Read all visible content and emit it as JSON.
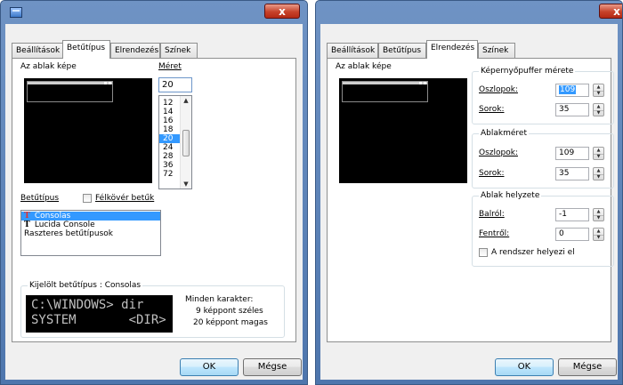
{
  "left_window": {
    "title": "",
    "close_label": "x",
    "tabs": [
      {
        "label": "Beállítások",
        "active": false
      },
      {
        "label": "Betűtípus",
        "active": true
      },
      {
        "label": "Elrendezés",
        "active": false
      },
      {
        "label": "Színek",
        "active": false
      }
    ],
    "preview_label": "Az ablak képe",
    "size_label": "Méret",
    "size_value": "20",
    "size_options": [
      "12",
      "14",
      "16",
      "18",
      "20",
      "24",
      "28",
      "36",
      "72"
    ],
    "selected_size": "20",
    "font_label": "Betűtípus",
    "bold_label": "Félkövér betűk",
    "bold_checked": false,
    "fonts": [
      {
        "icon": "T",
        "name": "Consolas",
        "selected": true
      },
      {
        "icon": "T",
        "name": "Lucida Console",
        "selected": false
      },
      {
        "icon": "",
        "name": "Raszteres betűtípusok",
        "selected": false
      }
    ],
    "selected_font_group_title": "Kijelölt betűtípus : Consolas",
    "sample_line1": "C:\\WINDOWS> dir",
    "sample_line2": "SYSTEM       <DIR>",
    "info_title": "Minden karakter:",
    "info_width": "9 képpont széles",
    "info_height": "20 képpont magas",
    "ok_label": "OK",
    "cancel_label": "Mégse"
  },
  "right_window": {
    "title": "",
    "close_label": "x",
    "tabs": [
      {
        "label": "Beállítások",
        "active": false
      },
      {
        "label": "Betűtípus",
        "active": false
      },
      {
        "label": "Elrendezés",
        "active": true
      },
      {
        "label": "Színek",
        "active": false
      }
    ],
    "preview_label": "Az ablak képe",
    "buffer_group_title": "Képernyőpuffer mérete",
    "buffer_columns_label": "Oszlopok:",
    "buffer_columns_value": "109",
    "buffer_rows_label": "Sorok:",
    "buffer_rows_value": "35",
    "window_size_group_title": "Ablakméret",
    "window_columns_label": "Oszlopok:",
    "window_columns_value": "109",
    "window_rows_label": "Sorok:",
    "window_rows_value": "35",
    "position_group_title": "Ablak helyzete",
    "left_label": "Balról:",
    "left_value": "-1",
    "top_label": "Fentről:",
    "top_value": "0",
    "system_position_label": "A rendszer helyezi el",
    "system_position_checked": false,
    "ok_label": "OK",
    "cancel_label": "Mégse"
  },
  "colors": {
    "titlebar": "#5a80b6",
    "close_button": "#c7422a",
    "selection": "#3399ff",
    "dialog_bg": "#f0f0f0"
  }
}
